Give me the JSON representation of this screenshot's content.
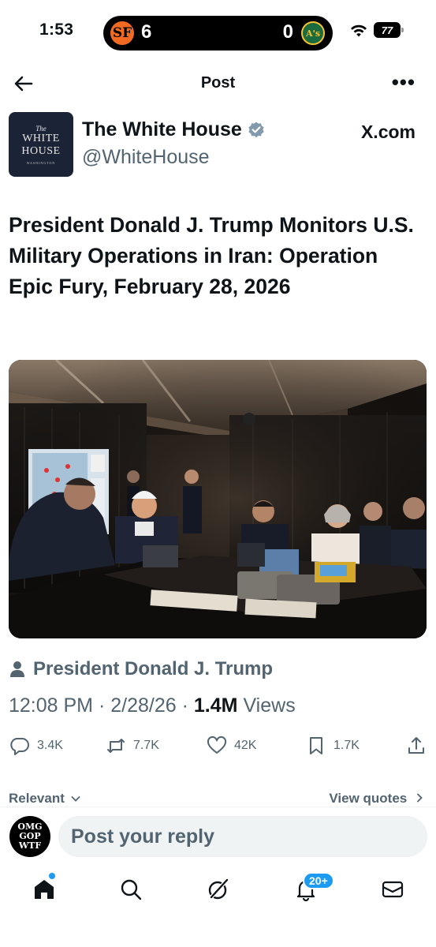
{
  "status_bar": {
    "time": "1:53",
    "home_team_logo": "SF",
    "home_score": "6",
    "away_score": "0",
    "away_team_logo": "A's",
    "battery": "77",
    "icons": [
      "wifi-icon",
      "battery-icon"
    ]
  },
  "nav": {
    "title": "Post",
    "back_icon": "arrow-left-icon",
    "more_icon": "more-horizontal-icon",
    "more_label": "•••"
  },
  "author": {
    "logo_the": "The",
    "logo_line1": "WHITE",
    "logo_line2": "HOUSE",
    "logo_sub": "WASHINGTON",
    "name": "The White House",
    "handle": "@WhiteHouse",
    "source": "X.com",
    "verified_color": "#829aab"
  },
  "post": {
    "headline": "President Donald J. Trump Monitors U.S. Military Operations in Iran: Operation Epic Fury, February 28, 2026",
    "photo_description_icon": "photo",
    "person_tag": "President Donald J. Trump",
    "time": "12:08 PM",
    "date": "2/28/26",
    "views_count": "1.4M",
    "views_label": "Views"
  },
  "actions": {
    "replies": "3.4K",
    "reposts": "7.7K",
    "likes": "42K",
    "bookmarks": "1.7K"
  },
  "replies_header": {
    "sort_label": "Relevant",
    "view_quotes": "View quotes"
  },
  "reply": {
    "avatar_line1": "OMG",
    "avatar_line2": "GOP",
    "avatar_line3": "WTF",
    "placeholder": "Post your reply"
  },
  "tabbar": {
    "notifications_badge": "20+",
    "accent_color": "#1d9bf0"
  }
}
